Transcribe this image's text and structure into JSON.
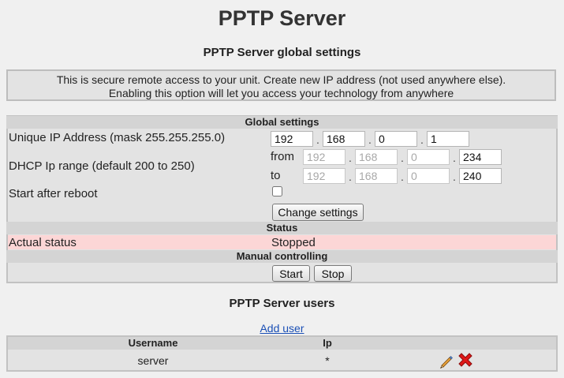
{
  "page": {
    "title": "PPTP Server",
    "subtitle": "PPTP Server global settings",
    "info_line1": "This is secure remote access to your unit. Create new IP address (not used anywhere else).",
    "info_line2": "Enabling this option will let you access your technology from anywhere"
  },
  "global": {
    "header": "Global settings",
    "ip_label": "Unique IP Address (mask 255.255.255.0)",
    "ip": [
      "192",
      "168",
      "0",
      "1"
    ],
    "dhcp_label": "DHCP Ip range (default 200 to 250)",
    "from_label": "from",
    "to_label": "to",
    "from": [
      "192",
      "168",
      "0",
      "234"
    ],
    "to": [
      "192",
      "168",
      "0",
      "240"
    ],
    "dot": ".",
    "reboot_label": "Start after reboot",
    "reboot_checked": false,
    "change_button": "Change settings"
  },
  "status": {
    "header": "Status",
    "label": "Actual status",
    "value": "Stopped",
    "color": "#fcd6d6"
  },
  "manual": {
    "header": "Manual controlling",
    "start_button": "Start",
    "stop_button": "Stop"
  },
  "users": {
    "title": "PPTP Server users",
    "add_link": "Add user",
    "columns": [
      "Username",
      "Ip"
    ],
    "rows": [
      {
        "username": "server",
        "ip": "*",
        "actions": [
          "edit-pencil-icon",
          "delete-x-icon"
        ]
      }
    ]
  }
}
